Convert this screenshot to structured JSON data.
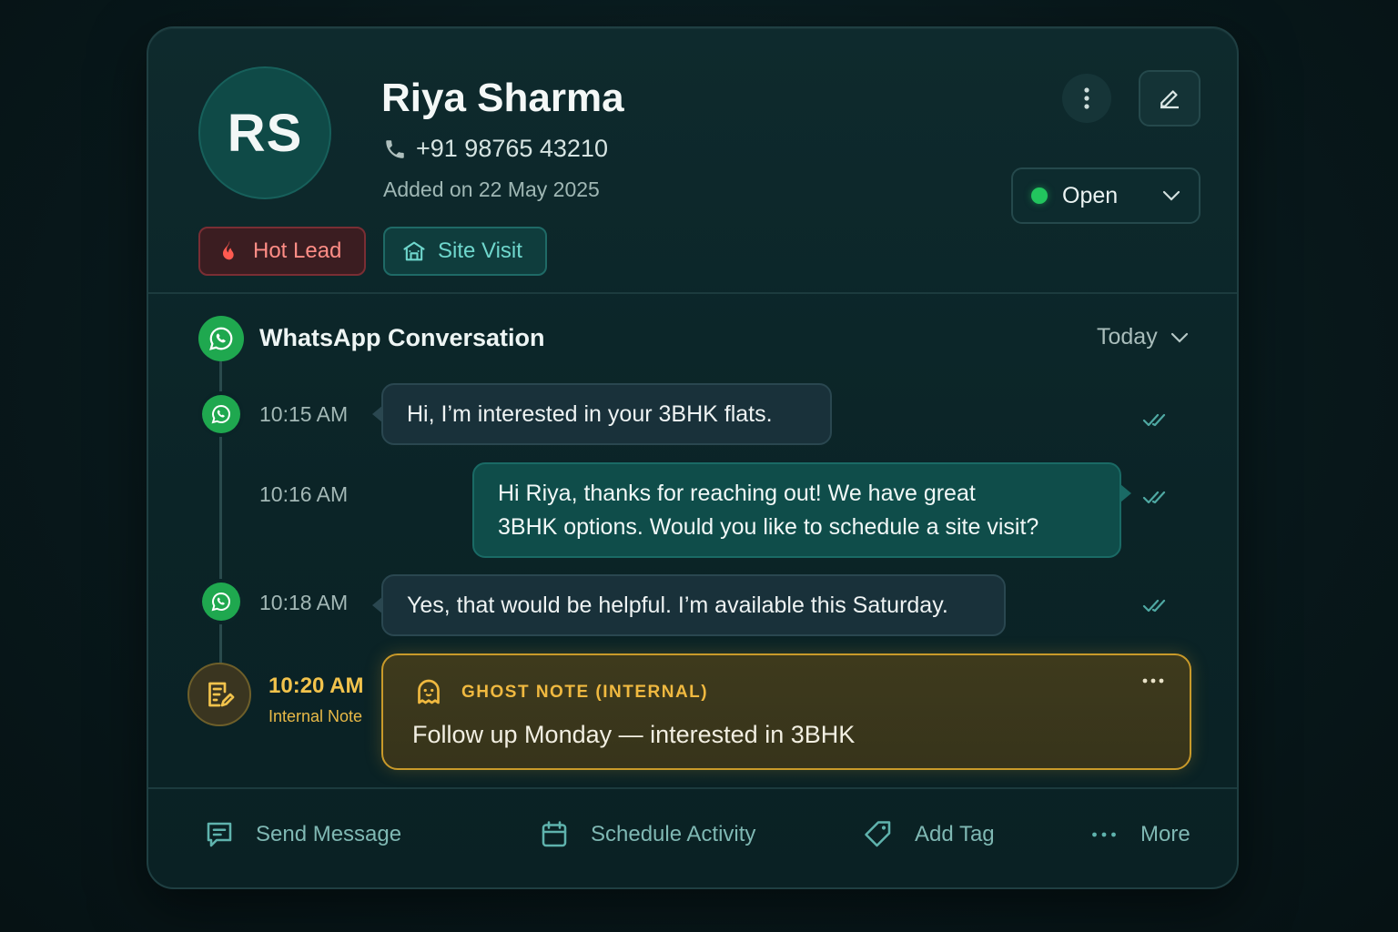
{
  "contact": {
    "initials": "RS",
    "name": "Riya Sharma",
    "phone": "+91 98765 43210",
    "added": "Added on 22 May 2025"
  },
  "tags": {
    "hot": "Hot Lead",
    "site": "Site Visit"
  },
  "status": {
    "label": "Open",
    "color": "#22c55e"
  },
  "conversation": {
    "title": "WhatsApp Conversation",
    "filter": "Today",
    "messages": [
      {
        "time": "10:15 AM",
        "text": "Hi, I’m interested in your 3BHK flats.",
        "direction": "in"
      },
      {
        "time": "10:16 AM",
        "line1": "Hi Riya, thanks for reaching out! We have great",
        "line2": "3BHK options. Would you like to schedule a site visit?",
        "direction": "out"
      },
      {
        "time": "10:18 AM",
        "text": "Yes, that would be helpful. I’m available this Saturday.",
        "direction": "in"
      }
    ],
    "note": {
      "time": "10:20 AM",
      "sub": "Internal Note",
      "label": "GHOST NOTE (INTERNAL)",
      "text": "Follow up Monday — interested in 3BHK"
    }
  },
  "actions": {
    "send": "Send Message",
    "schedule": "Schedule Activity",
    "tag": "Add Tag",
    "more": "More"
  },
  "colors": {
    "accent": "#1fa84f",
    "note": "#c99a2a",
    "hot": "#ff8d86",
    "site": "#6fd7cd"
  }
}
